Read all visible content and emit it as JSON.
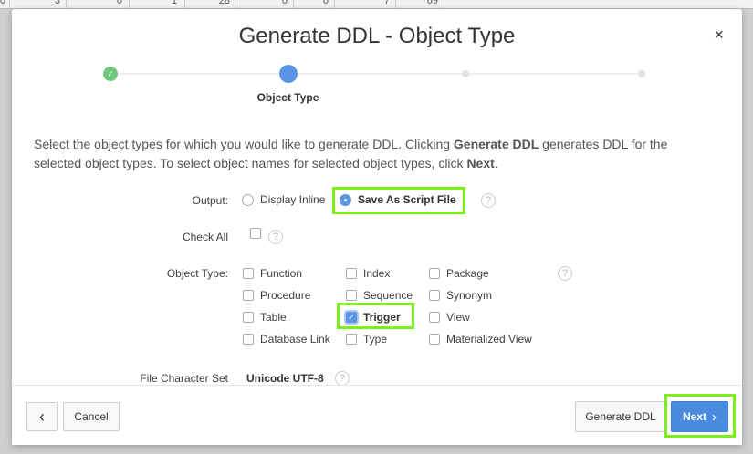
{
  "background_row": [
    "0",
    "3",
    "0",
    "1",
    "28",
    "0",
    "0",
    "7",
    "69"
  ],
  "dialog": {
    "title": "Generate DDL - Object Type",
    "close": "×"
  },
  "wizard": {
    "current_step": "Object Type",
    "colors": {
      "done": "#6cc97c",
      "current": "#5a95e6",
      "pending": "#e2e2e2"
    }
  },
  "intro": {
    "p1": "Select the object types for which you would like to generate DDL. Clicking ",
    "b1": "Generate DDL",
    "p2": " generates DDL for the selected object types. To select object names for selected object types, click ",
    "b2": "Next",
    "p3": "."
  },
  "output": {
    "label": "Output:",
    "options": [
      "Display Inline",
      "Save As Script File"
    ],
    "selected": "Save As Script File"
  },
  "check_all": {
    "label": "Check All",
    "checked": false
  },
  "object_type": {
    "label": "Object Type:",
    "items": [
      {
        "label": "Function",
        "checked": false
      },
      {
        "label": "Index",
        "checked": false
      },
      {
        "label": "Package",
        "checked": false
      },
      {
        "label": "Procedure",
        "checked": false
      },
      {
        "label": "Sequence",
        "checked": false
      },
      {
        "label": "Synonym",
        "checked": false
      },
      {
        "label": "Table",
        "checked": false
      },
      {
        "label": "Trigger",
        "checked": true
      },
      {
        "label": "View",
        "checked": false
      },
      {
        "label": "Database Link",
        "checked": false
      },
      {
        "label": "Type",
        "checked": false
      },
      {
        "label": "Materialized View",
        "checked": false
      }
    ]
  },
  "charset": {
    "label": "File Character Set",
    "value": "Unicode UTF-8"
  },
  "help": "?",
  "footer": {
    "back": "‹",
    "cancel": "Cancel",
    "generate": "Generate DDL",
    "next": "Next",
    "next_chevron": "›"
  },
  "highlight_color": "#7cf01e"
}
